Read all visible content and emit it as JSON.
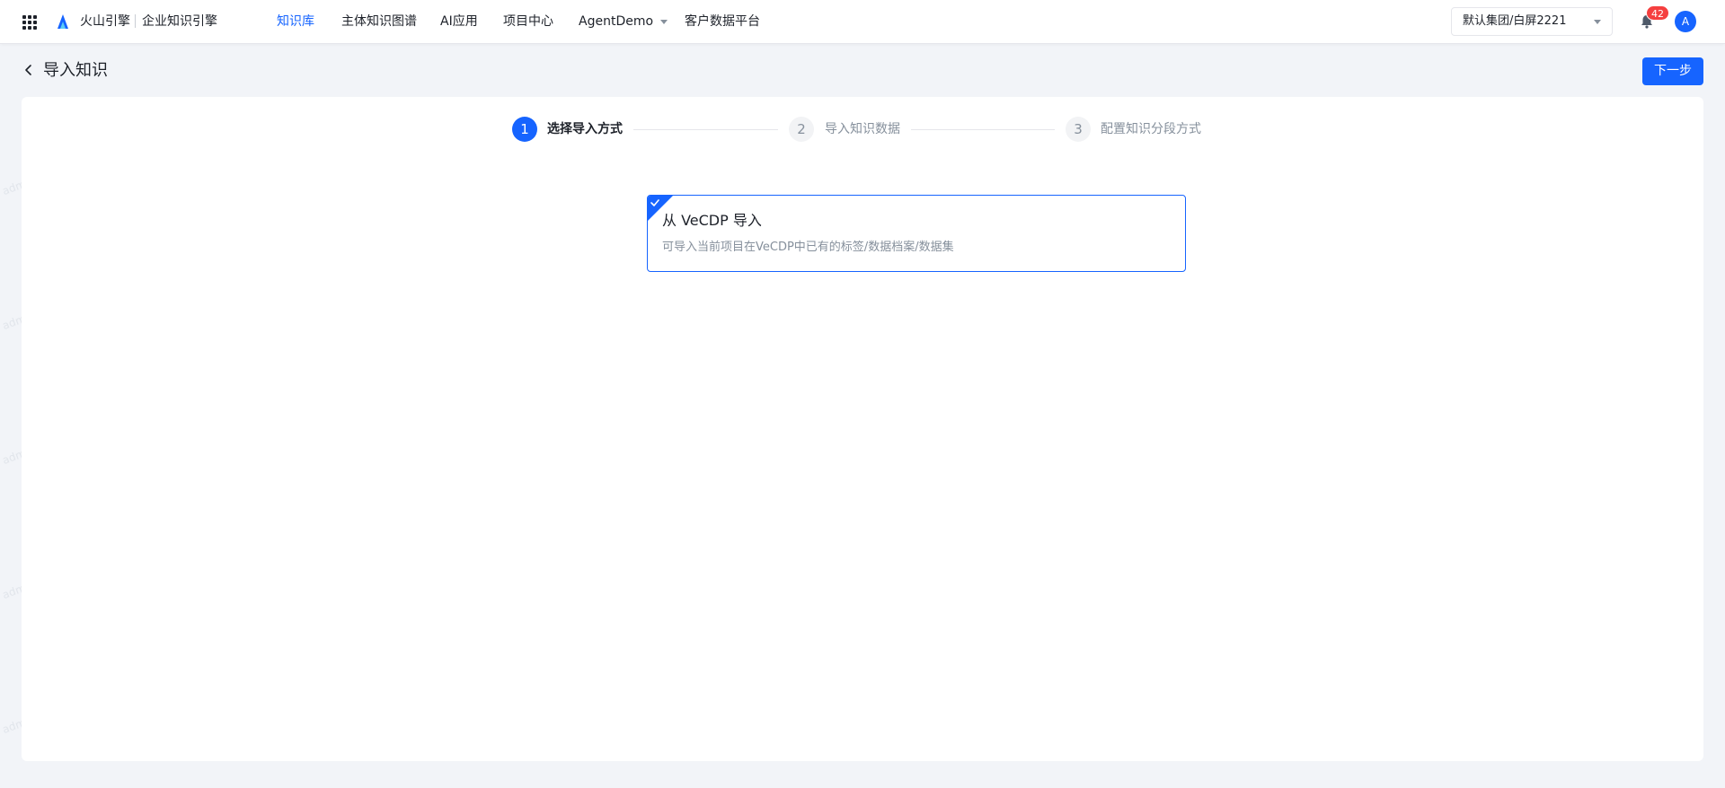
{
  "header": {
    "brand": "火山引擎",
    "product": "企业知识引擎",
    "nav": [
      {
        "label": "知识库",
        "active": true
      },
      {
        "label": "主体知识图谱",
        "active": false
      },
      {
        "label": "AI应用",
        "active": false
      },
      {
        "label": "项目中心",
        "active": false
      },
      {
        "label": "AgentDemo",
        "active": false,
        "dropdown": true
      },
      {
        "label": "客户数据平台",
        "active": false
      }
    ],
    "org_select": "默认集团/白屏2221",
    "notification_count": "42",
    "avatar_initial": "A"
  },
  "page": {
    "title": "导入知识",
    "next_button": "下一步"
  },
  "steps": [
    {
      "number": "1",
      "label": "选择导入方式",
      "state": "active"
    },
    {
      "number": "2",
      "label": "导入知识数据",
      "state": "inactive"
    },
    {
      "number": "3",
      "label": "配置知识分段方式",
      "state": "inactive"
    }
  ],
  "import_option": {
    "title": "从 VeCDP 导入",
    "description": "可导入当前项目在VeCDP中已有的标签/数据档案/数据集",
    "selected": true
  },
  "watermark": "admin",
  "colors": {
    "primary": "#1664ff",
    "badge": "#f53f3f",
    "page_bg": "#f2f4f8"
  }
}
